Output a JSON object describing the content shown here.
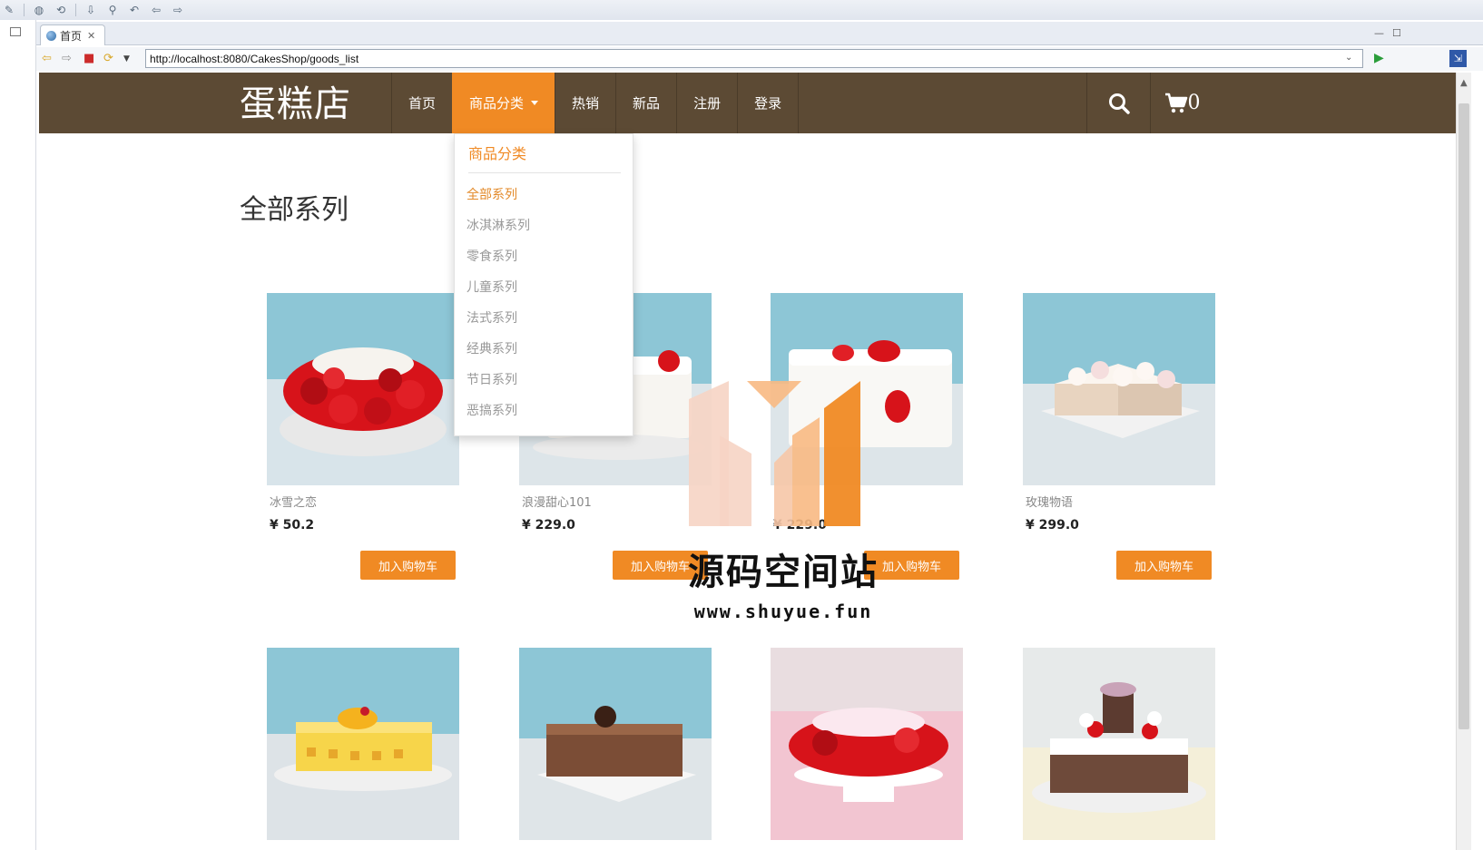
{
  "ide": {
    "tab_label": "首页",
    "tab_close": "✕",
    "url": "http://localhost:8080/CakesShop/goods_list"
  },
  "site": {
    "brand": "蛋糕店",
    "nav": [
      {
        "label": "首页"
      },
      {
        "label": "商品分类"
      },
      {
        "label": "热销"
      },
      {
        "label": "新品"
      },
      {
        "label": "注册"
      },
      {
        "label": "登录"
      }
    ],
    "cart_count": "0",
    "section_title": "全部系列"
  },
  "dropdown": {
    "header": "商品分类",
    "items": [
      "全部系列",
      "冰淇淋系列",
      "零食系列",
      "儿童系列",
      "法式系列",
      "经典系列",
      "节日系列",
      "恶搞系列"
    ]
  },
  "products": [
    {
      "name": "冰雪之恋",
      "price": "¥ 50.2",
      "button": "加入购物车"
    },
    {
      "name": "浪漫甜心101",
      "price": "¥ 229.0",
      "button": "加入购物车"
    },
    {
      "name": "",
      "price": "¥ 229.0",
      "button": "加入购物车"
    },
    {
      "name": "玫瑰物语",
      "price": "¥ 299.0",
      "button": "加入购物车"
    }
  ],
  "watermark": {
    "text": "源码空间站",
    "url": "www.shuyue.fun"
  },
  "colors": {
    "nav_bg": "#5c4a34",
    "accent": "#f08a24"
  }
}
